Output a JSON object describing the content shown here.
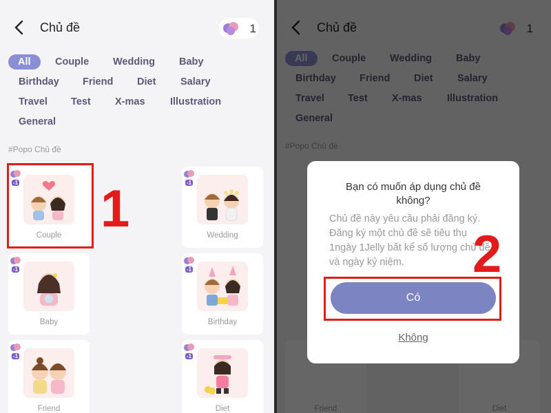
{
  "header": {
    "title": "Chủ đề",
    "jelly_count": "1"
  },
  "tags": [
    "All",
    "Couple",
    "Wedding",
    "Baby",
    "Birthday",
    "Friend",
    "Diet",
    "Salary",
    "Travel",
    "Test",
    "X-mas",
    "Illustration",
    "General"
  ],
  "section_title": "#Popo Chủ đề",
  "cards": [
    {
      "label": "Couple",
      "cost": "-1"
    },
    {
      "label": "Wedding",
      "cost": "-1"
    },
    {
      "label": "Baby",
      "cost": "-1"
    },
    {
      "label": "Birthday",
      "cost": "-1"
    },
    {
      "label": "Friend",
      "cost": "-1"
    },
    {
      "label": "Diet",
      "cost": "-1"
    }
  ],
  "annotations": {
    "step1": "1",
    "step2": "2"
  },
  "dialog": {
    "title": "Bạn có muốn áp dụng chủ đề không?",
    "body": "Chủ đề này yêu cầu phải đăng ký. Đăng ký một chủ đề sẽ tiêu thụ 1ngày 1Jelly bất kể số lượng chủ đề và ngày kỷ niệm.",
    "yes_label": "Có",
    "no_label": "Không"
  },
  "colors": {
    "accent": "#8a8fd4",
    "button": "#7c84c2",
    "highlight": "#e21b1b"
  }
}
